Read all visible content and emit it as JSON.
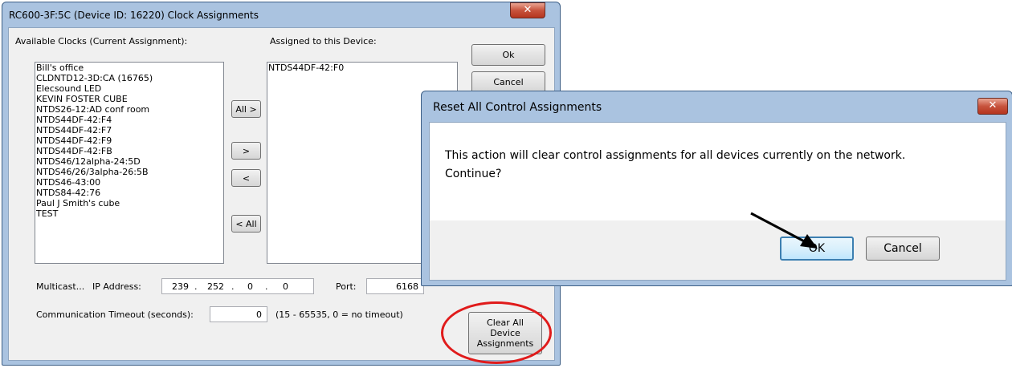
{
  "main_window": {
    "title": "RC600-3F:5C (Device ID: 16220) Clock Assignments",
    "close_glyph": "✕",
    "available_label": "Available Clocks (Current Assignment):",
    "assigned_label": "Assigned to this Device:",
    "available_clocks": [
      "Bill's office",
      "CLDNTD12-3D:CA (16765)",
      "Elecsound LED",
      "KEVIN FOSTER CUBE",
      "NTDS26-12:AD conf room",
      "NTDS44DF-42:F4",
      "NTDS44DF-42:F7",
      "NTDS44DF-42:F9",
      "NTDS44DF-42:FB",
      "NTDS46/12alpha-24:5D",
      "NTDS46/26/3alpha-26:5B",
      "NTDS46-43:00",
      "NTDS84-42:76",
      "Paul J Smith's cube",
      "TEST"
    ],
    "assigned_clocks": [
      "NTDS44DF-42:F0"
    ],
    "buttons": {
      "all_right": "All >",
      "right": ">",
      "left": "<",
      "all_left": "< All",
      "ok": "Ok",
      "cancel": "Cancel",
      "clear_all": "Clear All Device Assignments"
    },
    "multicast_label": "Multicast...",
    "ip_label": "IP Address:",
    "ip": [
      "239",
      "252",
      "0",
      "0"
    ],
    "ip_separator": ".",
    "port_label": "Port:",
    "port_value": "6168",
    "timeout_label": "Communication Timeout (seconds):",
    "timeout_value": "0",
    "timeout_hint": "(15 - 65535, 0 = no timeout)"
  },
  "reset_dialog": {
    "title": "Reset All Control Assignments",
    "close_glyph": "✕",
    "message_line1": "This action will clear control assignments for all devices currently on the network.",
    "message_line2": "Continue?",
    "ok_label": "OK",
    "cancel_label": "Cancel"
  },
  "colors": {
    "annotation_circle": "#e01b1b",
    "annotation_arrow": "#000000",
    "window_frame": "#aac3e0"
  }
}
